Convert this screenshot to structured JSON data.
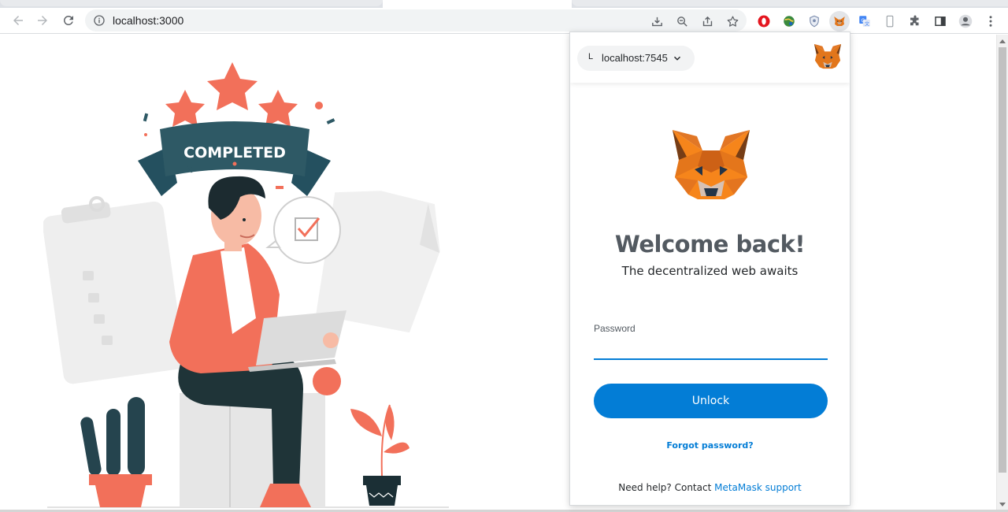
{
  "browser": {
    "url": "localhost:3000",
    "toolbar_icons": [
      "back-icon",
      "forward-icon",
      "reload-icon",
      "info-icon",
      "install-icon",
      "zoom-out-icon",
      "share-icon",
      "bookmark-star-icon"
    ],
    "extension_icons": [
      "opera-icon",
      "globe-extension-icon",
      "shield-extension-icon",
      "metamask-fox-icon",
      "translate-icon",
      "phone-frame-icon",
      "extensions-puzzle-icon",
      "side-panel-icon",
      "profile-avatar-icon",
      "kebab-menu-icon"
    ]
  },
  "illustration": {
    "banner_text": "COMPLETED"
  },
  "metamask": {
    "network": {
      "initial": "L",
      "label": "localhost:7545"
    },
    "title": "Welcome back!",
    "subtitle": "The decentralized web awaits",
    "password": {
      "label": "Password",
      "value": ""
    },
    "unlock_label": "Unlock",
    "forgot_label": "Forgot password?",
    "help_prefix": "Need help? Contact",
    "help_link": "MetaMask support",
    "colors": {
      "primary": "#037dd6",
      "title": "#535a61",
      "fox_orange": "#e2761b"
    }
  }
}
